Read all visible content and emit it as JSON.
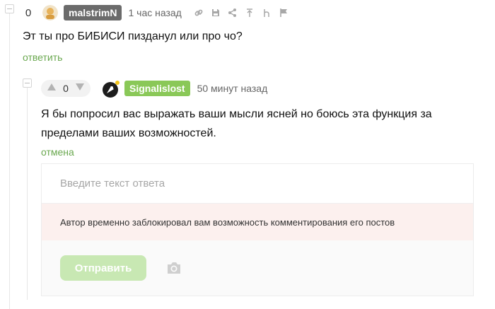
{
  "comment1": {
    "rating": "0",
    "author": "malstrimN",
    "time": "1 час назад",
    "text": "Эт ты про БИБИСИ пизданул или про чо?",
    "reply_label": "ответить",
    "tools": [
      "link-icon",
      "save-icon",
      "share-icon",
      "up-arrow-icon",
      "branch-icon",
      "flag-icon"
    ]
  },
  "comment2": {
    "rating": "0",
    "author": "Signalislost",
    "time": "50 минут назад",
    "text_line1": "Я бы попросил вас выражать ваши мысли ясней но боюсь эта функция за",
    "text_line2": "пределами ваших возможностей.",
    "cancel_label": "отмена"
  },
  "reply_form": {
    "placeholder": "Введите текст ответа",
    "blocked_message": "Автор временно заблокировал вам возможность комментирования его постов",
    "submit_label": "Отправить"
  },
  "colors": {
    "accent_green": "#6aa84f",
    "badge_green": "#8ac858",
    "badge_gray": "#6b6b6b",
    "blocked_bg": "#fcf0ee",
    "button_disabled": "#c8e8b3"
  }
}
